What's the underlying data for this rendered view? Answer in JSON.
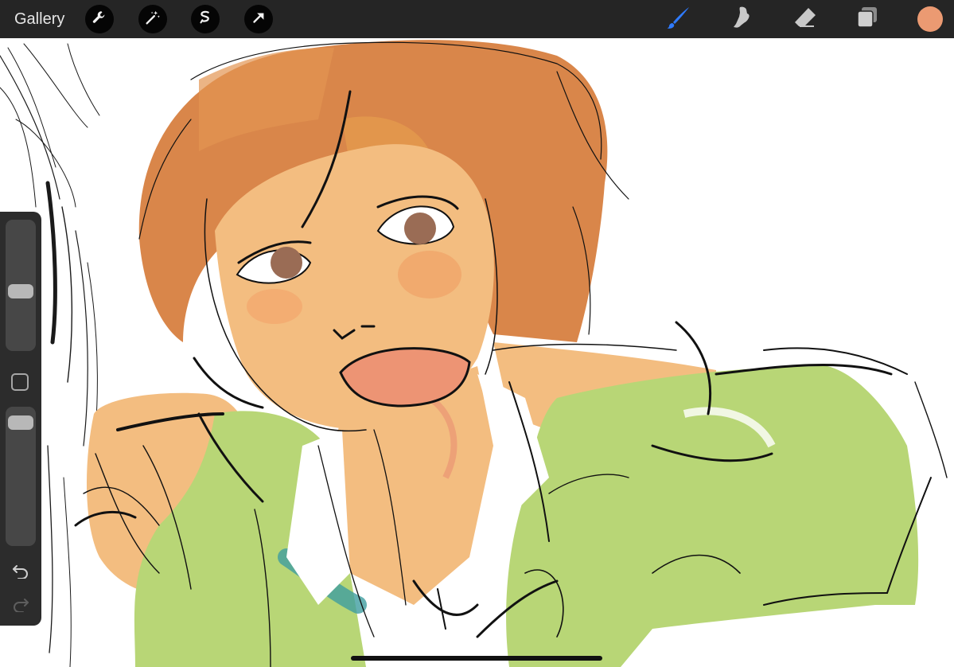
{
  "toolbar": {
    "gallery_label": "Gallery",
    "left_tools": [
      "wrench-icon",
      "magic-wand-icon",
      "selection-icon",
      "transform-arrow-icon"
    ],
    "right_tools": [
      "brush-icon",
      "smudge-icon",
      "eraser-icon",
      "layers-icon"
    ],
    "active_tool": "brush-icon",
    "active_color": "#EB9A72"
  },
  "sidebar": {
    "brush_size_level": 0.45,
    "opacity_level": 0.95,
    "undo_icon": "undo-icon",
    "redo_icon": "redo-icon"
  },
  "colors": {
    "toolbar_bg": "#252525",
    "accent_blue": "#2F7BFF",
    "hair": "#D9864A",
    "skin": "#F3BD80",
    "jacket": "#B8D676"
  }
}
